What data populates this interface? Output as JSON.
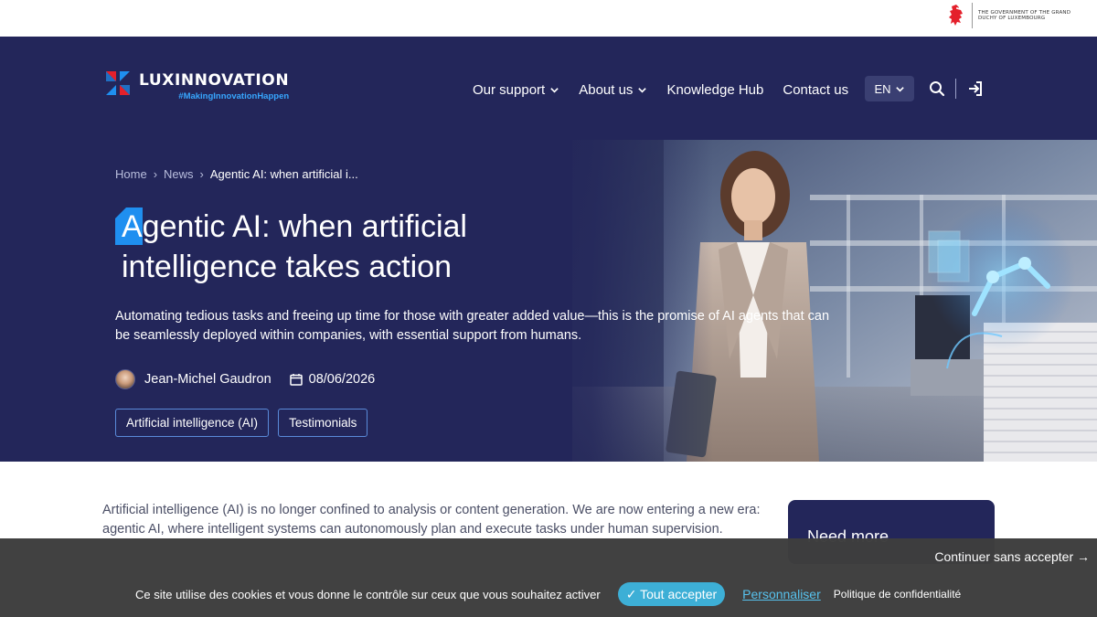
{
  "gov": {
    "text": "THE GOVERNMENT OF THE GRAND DUCHY OF LUXEMBOURG"
  },
  "header": {
    "brand": "LUXINNOVATION",
    "tagline": "#MakingInnovationHappen",
    "nav": [
      {
        "label": "Our support",
        "dropdown": true
      },
      {
        "label": "About us",
        "dropdown": true
      },
      {
        "label": "Knowledge Hub",
        "dropdown": false
      },
      {
        "label": "Contact us",
        "dropdown": false
      }
    ],
    "language": "EN",
    "icons": [
      "search-icon",
      "login-icon"
    ]
  },
  "breadcrumb": {
    "items": [
      "Home",
      "News"
    ],
    "current": "Agentic AI: when artificial i..."
  },
  "article": {
    "title": "Agentic AI: when artificial intelligence takes action",
    "lead": "Automating tedious tasks and freeing up time for those with greater added value—this is the promise of AI agents that can be seamlessly deployed within companies, with essential support from humans.",
    "author": "Jean-Michel Gaudron",
    "date": "08/06/2026",
    "tags": [
      "Artificial intelligence (AI)",
      "Testimonials"
    ],
    "body": "Artificial intelligence (AI) is no longer confined to analysis or content generation. We are now entering a new era: agentic AI, where intelligent systems can autonomously plan and execute tasks under human supervision."
  },
  "sidebar": {
    "card_title": "Need more"
  },
  "cookie": {
    "skip": "Continuer sans accepter →",
    "message": "Ce site utilise des cookies et vous donne le contrôle sur ceux que vous souhaitez activer",
    "accept": "✓ Tout accepter",
    "personalize": "Personnaliser",
    "policy": "Politique de confidentialité"
  },
  "colors": {
    "hero_bg": "#23265a",
    "accent_blue": "#37a7ff",
    "accent_red": "#e4202b",
    "cookie_bg": "#3e3e3e",
    "accept_bg": "#3aaed6"
  }
}
